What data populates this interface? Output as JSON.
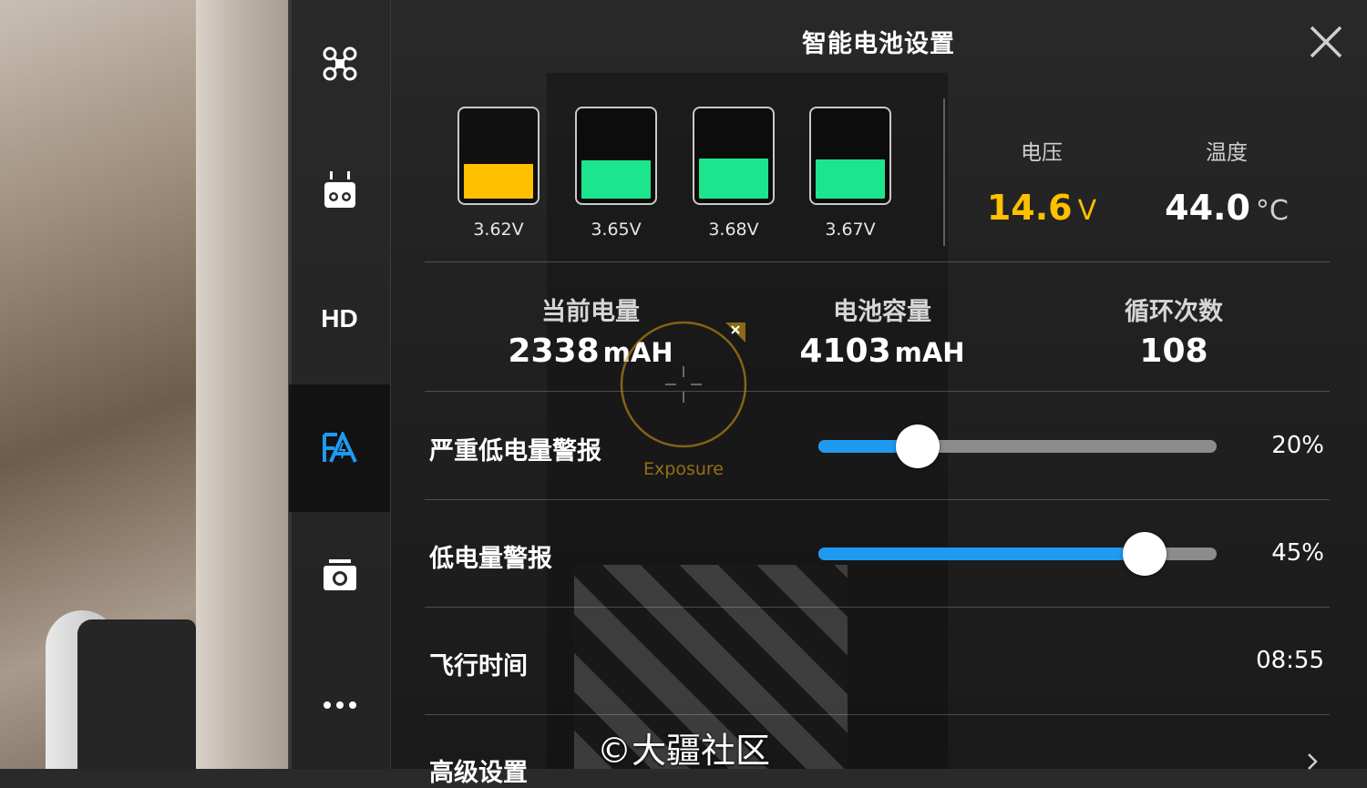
{
  "title": "智能电池设置",
  "cells": [
    {
      "voltage": "3.62V",
      "level": 0.4,
      "color": "#FFC000"
    },
    {
      "voltage": "3.65V",
      "level": 0.45,
      "color": "#1DE58D"
    },
    {
      "voltage": "3.68V",
      "level": 0.47,
      "color": "#1DE58D"
    },
    {
      "voltage": "3.67V",
      "level": 0.46,
      "color": "#1DE58D"
    }
  ],
  "voltage": {
    "label": "电压",
    "value": "14.6",
    "unit": "V",
    "color": "#FFC000"
  },
  "temperature": {
    "label": "温度",
    "value": "44.0",
    "unit": "°C"
  },
  "capacity": {
    "current": {
      "label": "当前电量",
      "value": "2338",
      "unit": "mAH"
    },
    "full": {
      "label": "电池容量",
      "value": "4103",
      "unit": "mAH"
    },
    "cycles": {
      "label": "循环次数",
      "value": "108"
    }
  },
  "critical_low": {
    "label": "严重低电量警报",
    "value": "20%",
    "level": 0.25
  },
  "low": {
    "label": "低电量警报",
    "value": "45%",
    "level": 0.82
  },
  "flight_time": {
    "label": "飞行时间",
    "value": "08:55"
  },
  "advanced": {
    "label": "高级设置"
  },
  "exposure": {
    "label": "Exposure"
  },
  "watermark": "©大疆社区",
  "sidebar": {
    "icons": [
      "aircraft-icon",
      "remote-controller-icon",
      "hd-icon",
      "battery-settings-icon",
      "camera-icon",
      "more-icon"
    ],
    "hd_label": "HD"
  },
  "colors": {
    "accent": "#1E9BF0",
    "warning": "#FFC000",
    "good": "#1DE58D"
  }
}
